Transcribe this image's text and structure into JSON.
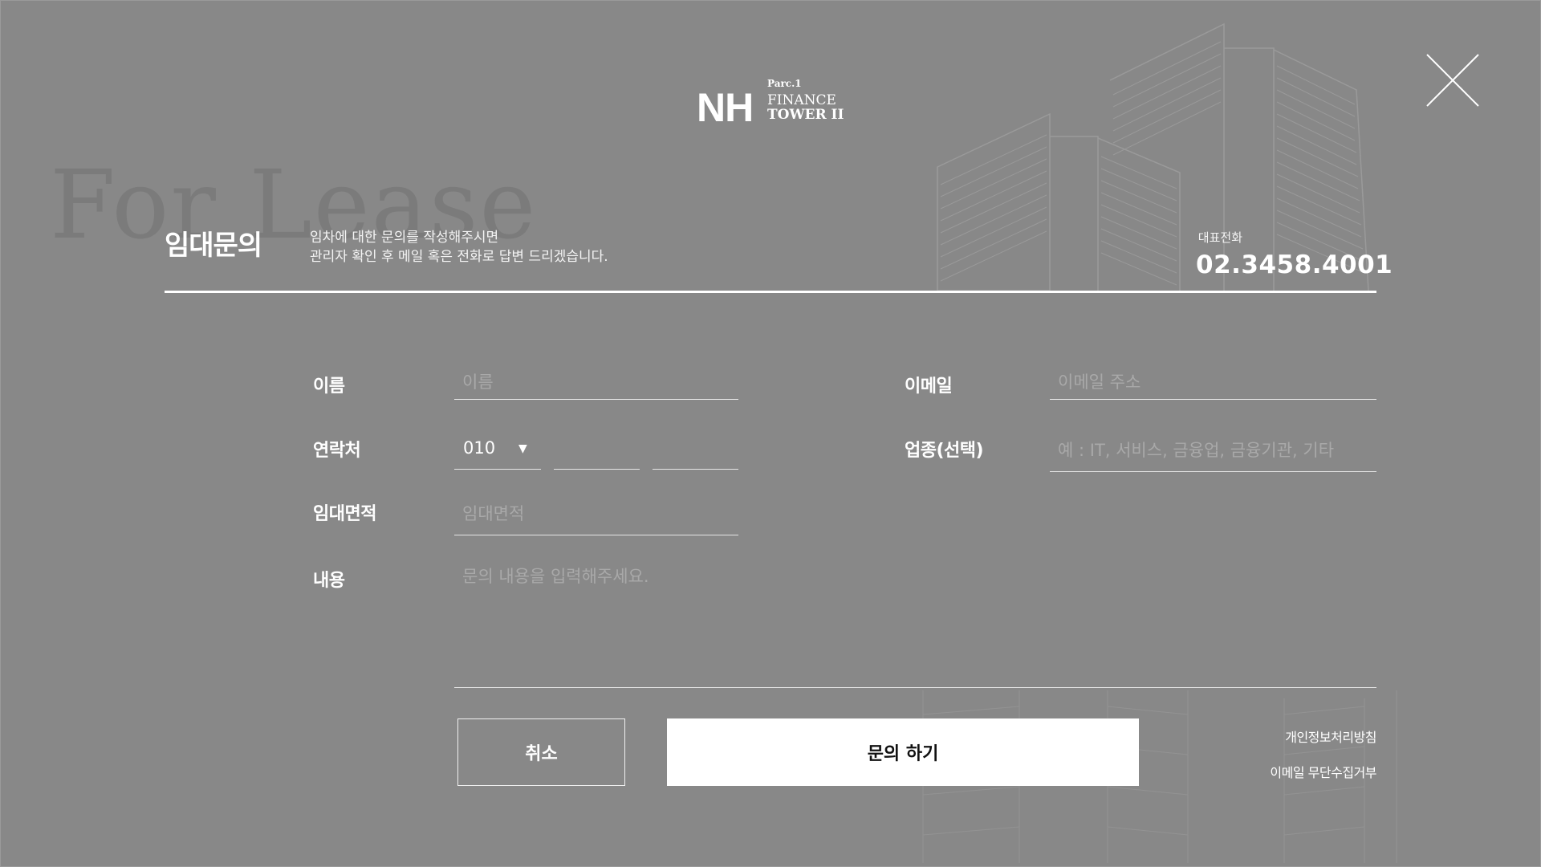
{
  "logo": {
    "parc": "Parc.1",
    "nh": "NH",
    "line1": "FINANCE",
    "line2": "TOWER II"
  },
  "watermark": "For Lease",
  "header": {
    "title": "임대문의",
    "intro_line1": "임차에 대한 문의를 작성해주시면",
    "intro_line2": "관리자 확인 후 메일 혹은 전화로 답변 드리겠습니다.",
    "phone_label": "대표전화",
    "phone_number": "02.3458.4001"
  },
  "form": {
    "name_label": "이름",
    "name_placeholder": "이름",
    "email_label": "이메일",
    "email_placeholder": "이메일 주소",
    "contact_label": "연락처",
    "contact_prefix": "010",
    "industry_label": "업종(선택)",
    "industry_placeholder": "예 : IT, 서비스, 금융업, 금융기관, 기타",
    "area_label": "임대면적",
    "area_placeholder": "임대면적",
    "content_label": "내용",
    "content_placeholder": "문의 내용을 입력해주세요."
  },
  "actions": {
    "cancel": "취소",
    "submit": "문의 하기",
    "privacy_link": "개인정보처리방침",
    "email_refusal_link": "이메일 무단수집거부"
  },
  "icons": {
    "close": "close-icon",
    "dropdown": "caret-down-icon"
  },
  "colors": {
    "background": "#888888",
    "text": "#ffffff",
    "submit_bg": "#ffffff",
    "submit_text": "#111111"
  }
}
